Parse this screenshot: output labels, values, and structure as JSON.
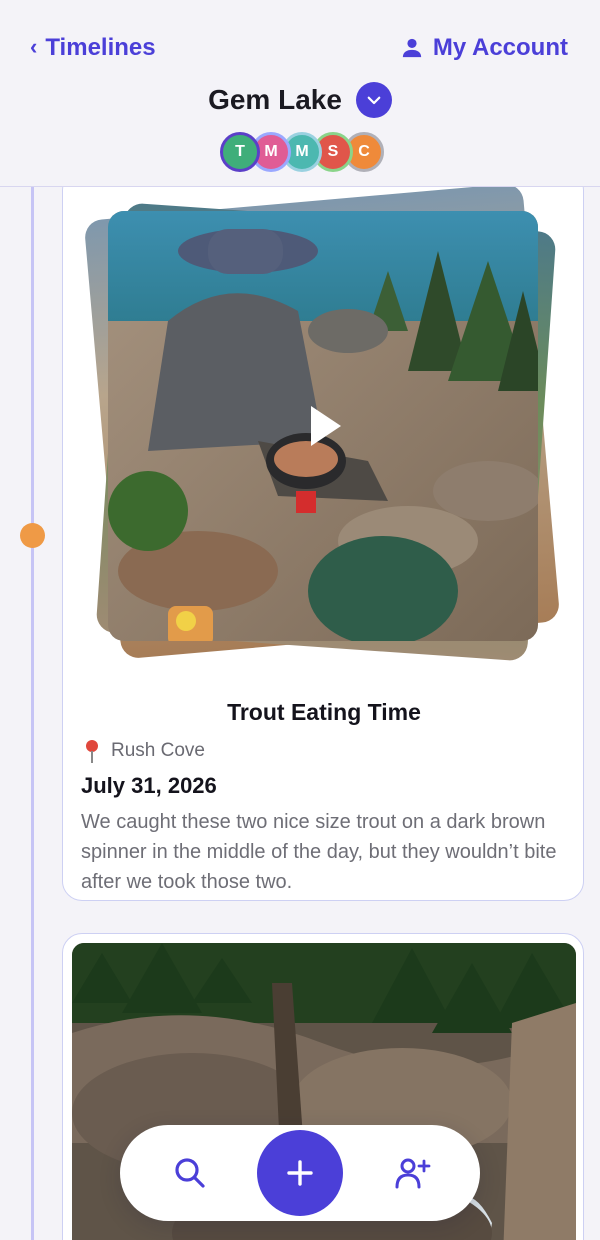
{
  "header": {
    "back_label": "Timelines",
    "account_label": "My Account",
    "title": "Gem Lake",
    "members": [
      {
        "initial": "T",
        "bg": "#3fae7a",
        "ring": "#5b3fc8"
      },
      {
        "initial": "M",
        "bg": "#e05c95",
        "ring": "#9aa8ff"
      },
      {
        "initial": "M",
        "bg": "#4cb8b0",
        "ring": "#9ad1e0"
      },
      {
        "initial": "S",
        "bg": "#e0564a",
        "ring": "#8ad48a"
      },
      {
        "initial": "C",
        "bg": "#ef8a3a",
        "ring": "#b0b0b8"
      }
    ]
  },
  "timeline": {
    "dot_color": "#ef9a46",
    "line_color": "#c6c4f5"
  },
  "entries": [
    {
      "title": "Trout Eating Time",
      "location": "Rush Cove",
      "date": "July 31, 2026",
      "description": "We caught these two nice size trout on a dark brown spinner in the middle of the day, but they wouldn’t bite after we took those two.",
      "media": "video",
      "photo_icon": "play-icon"
    },
    {
      "media": "photo"
    }
  ],
  "bottom_bar": {
    "search_icon": "search-icon",
    "add_icon": "plus-icon",
    "invite_icon": "add-user-icon"
  },
  "colors": {
    "accent": "#4b3fd8",
    "background": "#f4f3f8",
    "card_border": "#cdd0f3"
  }
}
